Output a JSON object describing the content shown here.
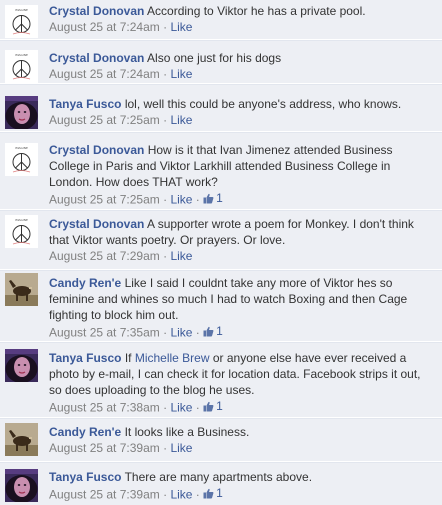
{
  "comments": [
    {
      "author": "Crystal Donovan",
      "avatar": "peace-logo-avatar",
      "text": "According to Viktor he has a private pool.",
      "time": "August 25 at 7:24am",
      "sep": "·",
      "like": "Like",
      "likes": ""
    },
    {
      "author": "Crystal Donovan",
      "avatar": "peace-logo-avatar",
      "text": "Also one just for his dogs",
      "time": "August 25 at 7:24am",
      "sep": "·",
      "like": "Like",
      "likes": ""
    },
    {
      "author": "Tanya Fusco",
      "avatar": "woman-photo-avatar",
      "text": "lol, well this could be anyone's address, who knows.",
      "time": "August 25 at 7:25am",
      "sep": "·",
      "like": "Like",
      "likes": ""
    },
    {
      "author": "Crystal Donovan",
      "avatar": "peace-logo-avatar",
      "text": "How is it that Ivan Jimenez attended Business College in Paris and Viktor Larkhill attended Business College in London. How does THAT work?",
      "time": "August 25 at 7:25am",
      "sep": "·",
      "like": "Like",
      "likes": "1"
    },
    {
      "author": "Crystal Donovan",
      "avatar": "peace-logo-avatar",
      "text": "A supporter wrote a poem for Monkey. I don't think that Viktor wants poetry. Or prayers. Or love.",
      "time": "August 25 at 7:29am",
      "sep": "·",
      "like": "Like",
      "likes": ""
    },
    {
      "author": "Candy Ren'e",
      "avatar": "horse-photo-avatar",
      "text": "Like I said I couldnt take any more of Viktor hes so feminine and whines so much I had to watch Boxing and then Cage fighting to block him out.",
      "time": "August 25 at 7:35am",
      "sep": "·",
      "like": "Like",
      "likes": "1"
    },
    {
      "author": "Tanya Fusco",
      "avatar": "woman-photo-avatar",
      "text_before": "If",
      "mention": "Michelle Brew",
      "text_after": "or anyone else have ever received a photo by e-mail, I can check it for location data. Facebook strips it out, so does uploading to the blog he uses.",
      "time": "August 25 at 7:38am",
      "sep": "·",
      "like": "Like",
      "likes": "1"
    },
    {
      "author": "Candy Ren'e",
      "avatar": "horse-photo-avatar",
      "text": "It looks like a Business.",
      "time": "August 25 at 7:39am",
      "sep": "·",
      "like": "Like",
      "likes": ""
    },
    {
      "author": "Tanya Fusco",
      "avatar": "woman-photo-avatar",
      "text": "There are many apartments above.",
      "time": "August 25 at 7:39am",
      "sep": "·",
      "like": "Like",
      "likes": "1"
    }
  ],
  "colors": {
    "link": "#3b5998",
    "meta": "#808080",
    "background": "#edeff4"
  }
}
